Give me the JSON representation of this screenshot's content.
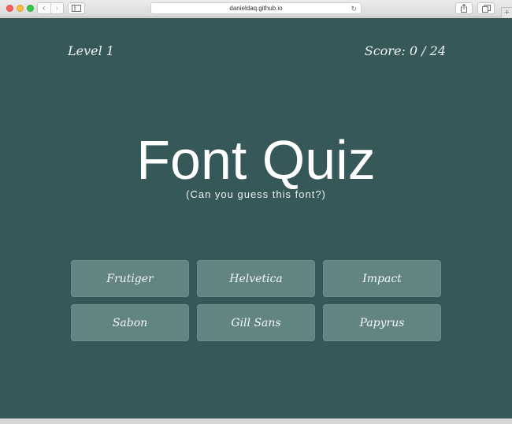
{
  "browser": {
    "url": "danieldaq.github.io",
    "back_glyph": "‹",
    "forward_glyph": "›",
    "reload_glyph": "↻",
    "plus_glyph": "+",
    "icons": [
      "sidebar-icon",
      "share-icon",
      "tabs-icon",
      "reload-icon"
    ]
  },
  "header": {
    "level": "Level 1",
    "score": "Score: 0 / 24"
  },
  "quiz": {
    "title": "Font Quiz",
    "subtitle": "(Can you guess this font?)"
  },
  "answers": [
    "Frutiger",
    "Helvetica",
    "Impact",
    "Sabon",
    "Gill Sans",
    "Papyrus"
  ],
  "colors": {
    "background": "#375858",
    "answer_button": "#628584",
    "text": "#ffffff"
  }
}
